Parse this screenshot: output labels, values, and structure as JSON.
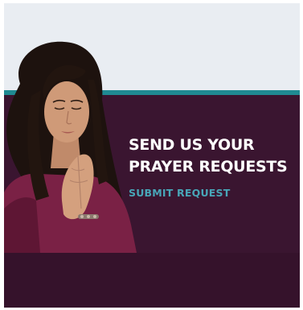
{
  "banner": {
    "headline_line1": "SEND US YOUR",
    "headline_line2": "PRAYER REQUESTS",
    "cta_label": "SUBMIT REQUEST"
  },
  "colors": {
    "background_top": "#e9edf2",
    "accent_stripe": "#1f8a92",
    "panel": "#3a1530",
    "headline_text": "#ffffff",
    "cta_text": "#48a6b8"
  }
}
